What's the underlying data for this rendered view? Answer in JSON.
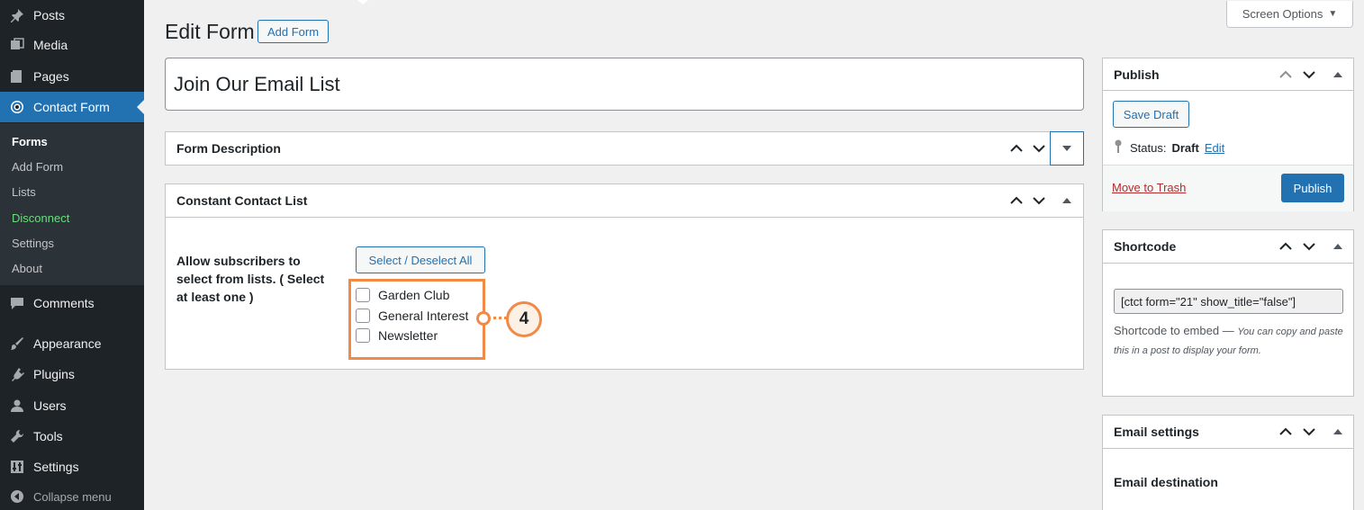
{
  "sidebar": {
    "items": [
      {
        "label": "Posts",
        "icon": "pin-icon"
      },
      {
        "label": "Media",
        "icon": "media-icon"
      },
      {
        "label": "Pages",
        "icon": "pages-icon"
      },
      {
        "label": "Contact Form",
        "icon": "constant-contact-icon"
      },
      {
        "label": "Comments",
        "icon": "comments-icon"
      },
      {
        "label": "Appearance",
        "icon": "paintbrush-icon"
      },
      {
        "label": "Plugins",
        "icon": "plugin-icon"
      },
      {
        "label": "Users",
        "icon": "users-icon"
      },
      {
        "label": "Tools",
        "icon": "wrench-icon"
      },
      {
        "label": "Settings",
        "icon": "settings-icon"
      }
    ],
    "submenu": [
      "Forms",
      "Add Form",
      "Lists",
      "Disconnect",
      "Settings",
      "About"
    ],
    "collapse_label": "Collapse menu"
  },
  "header": {
    "title": "Edit Form",
    "add_form": "Add Form",
    "screen_options": "Screen Options"
  },
  "form": {
    "title_value": "Join Our Email List"
  },
  "description_box": {
    "title": "Form Description"
  },
  "list_box": {
    "title": "Constant Contact List",
    "allow_label": "Allow subscribers to select from lists. ( Select at least one )",
    "select_all": "Select / Deselect All",
    "lists": [
      "Garden Club",
      "General Interest",
      "Newsletter"
    ],
    "callout_number": "4"
  },
  "publish_box": {
    "title": "Publish",
    "save_draft": "Save Draft",
    "status_label": "Status:",
    "status_value": "Draft",
    "status_edit": "Edit",
    "move_to_trash": "Move to Trash",
    "publish": "Publish"
  },
  "shortcode_box": {
    "title": "Shortcode",
    "value": "[ctct form=\"21\" show_title=\"false\"]",
    "help_prefix": "Shortcode to embed —",
    "help_text": "You can copy and paste this in a post to display your form."
  },
  "email_box": {
    "title": "Email settings",
    "destination_label": "Email destination"
  },
  "colors": {
    "sidebar_bg": "#1d2327",
    "accent": "#2271b1",
    "highlight": "#f08a46",
    "disconnect": "#68de7c"
  }
}
